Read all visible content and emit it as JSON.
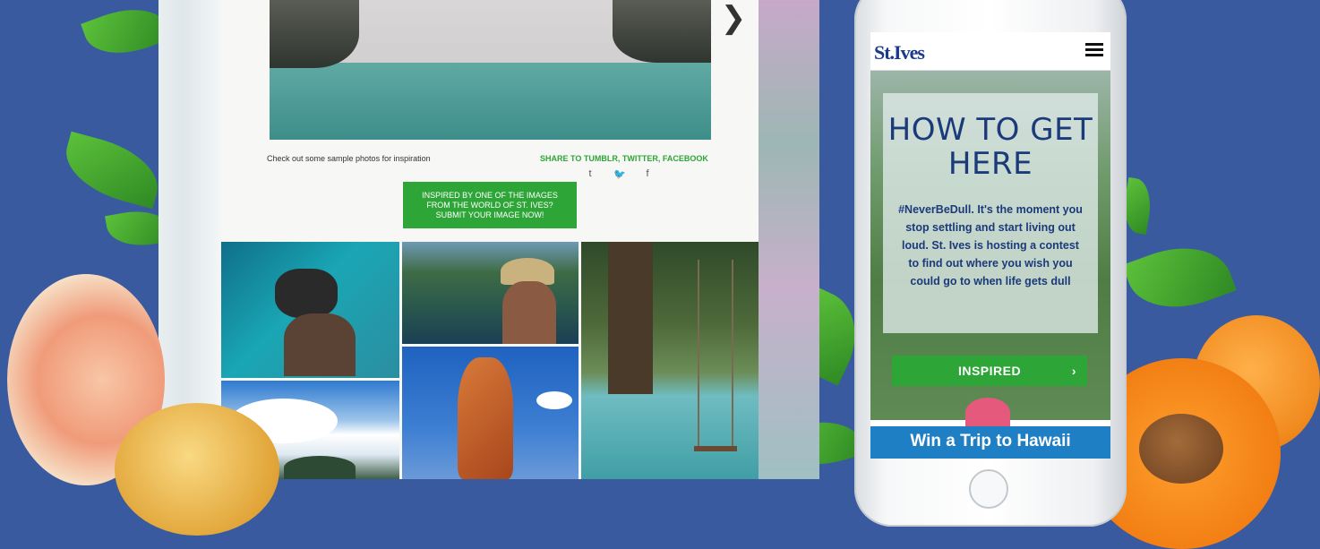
{
  "desktop": {
    "next_arrow": "❯",
    "inspiration_text": "Check out some sample photos for inspiration",
    "share_text": "SHARE TO TUMBLR, TWITTER, FACEBOOK",
    "social_icons": [
      "t",
      "🐦",
      "f"
    ],
    "submit_button": "INSPIRED BY ONE OF THE IMAGES FROM THE WORLD OF ST. IVES? SUBMIT YOUR IMAGE NOW!"
  },
  "phone": {
    "logo": "St.Ives",
    "title": "HOW TO GET HERE",
    "body": "#NeverBeDull. It's the moment you stop settling and start living out loud. St. Ives is hosting a contest to find out where you wish you could go to when life gets dull",
    "inspired_button": "INSPIRED",
    "inspired_chevron": "›",
    "banner": "Win a Trip to Hawaii"
  },
  "colors": {
    "background": "#3a5aa0",
    "accent_green": "#2ea537",
    "navy": "#1b3a7a"
  }
}
